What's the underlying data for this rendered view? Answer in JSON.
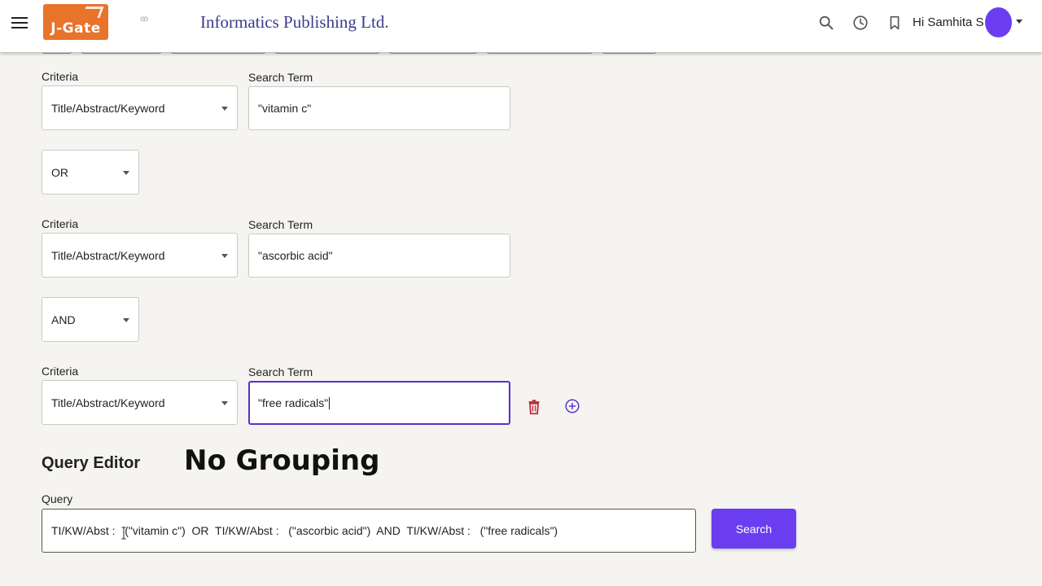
{
  "header": {
    "logo_text": "J-Gate",
    "small_glyph": "ꙭ",
    "brand": "Informatics Publishing Ltd.",
    "greeting": "Hi Samhita S",
    "icons": [
      "menu-icon",
      "search-icon",
      "history-icon",
      "bookmark-icon"
    ],
    "avatar_color": "#6a3ef0"
  },
  "rows": [
    {
      "criteria_label": "Criteria",
      "criteria_value": "Title/Abstract/Keyword",
      "term_label": "Search Term",
      "term_value": "\"vitamin c\""
    },
    {
      "criteria_label": "Criteria",
      "criteria_value": "Title/Abstract/Keyword",
      "term_label": "Search Term",
      "term_value": "\"ascorbic acid\""
    },
    {
      "criteria_label": "Criteria",
      "criteria_value": "Title/Abstract/Keyword",
      "term_label": "Search Term",
      "term_value": "\"free radicals\""
    }
  ],
  "operators": [
    "OR",
    "AND"
  ],
  "query_editor": {
    "title": "Query Editor",
    "overlay_note": "No Grouping",
    "query_label": "Query",
    "query_value": "TI/KW/Abst :   (\"vitamin c\")  OR  TI/KW/Abst :   (\"ascorbic acid\")  AND  TI/KW/Abst :   (\"free radicals\")",
    "search_label": "Search"
  },
  "colors": {
    "accent": "#6a3ef0",
    "brand_text": "#3d3a8c",
    "delete": "#c0283a",
    "logo": "#e8732a"
  }
}
